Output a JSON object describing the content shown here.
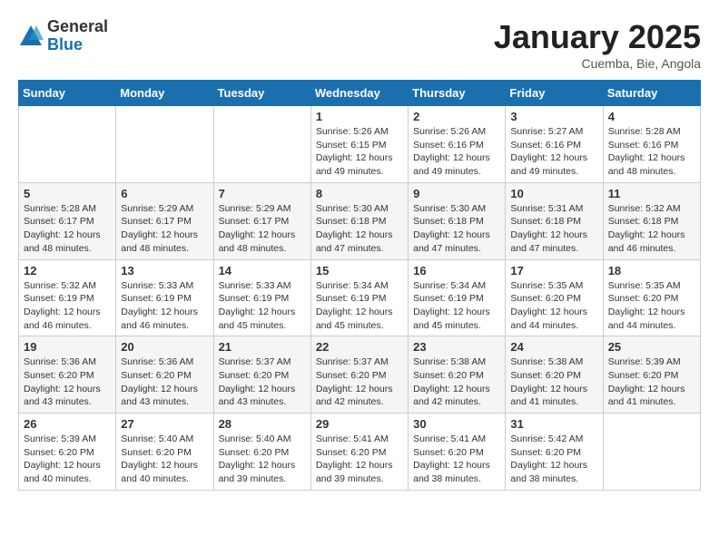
{
  "header": {
    "logo_general": "General",
    "logo_blue": "Blue",
    "month_title": "January 2025",
    "subtitle": "Cuemba, Bie, Angola"
  },
  "weekdays": [
    "Sunday",
    "Monday",
    "Tuesday",
    "Wednesday",
    "Thursday",
    "Friday",
    "Saturday"
  ],
  "weeks": [
    [
      {
        "day": "",
        "info": ""
      },
      {
        "day": "",
        "info": ""
      },
      {
        "day": "",
        "info": ""
      },
      {
        "day": "1",
        "info": "Sunrise: 5:26 AM\nSunset: 6:15 PM\nDaylight: 12 hours and 49 minutes."
      },
      {
        "day": "2",
        "info": "Sunrise: 5:26 AM\nSunset: 6:16 PM\nDaylight: 12 hours and 49 minutes."
      },
      {
        "day": "3",
        "info": "Sunrise: 5:27 AM\nSunset: 6:16 PM\nDaylight: 12 hours and 49 minutes."
      },
      {
        "day": "4",
        "info": "Sunrise: 5:28 AM\nSunset: 6:16 PM\nDaylight: 12 hours and 48 minutes."
      }
    ],
    [
      {
        "day": "5",
        "info": "Sunrise: 5:28 AM\nSunset: 6:17 PM\nDaylight: 12 hours and 48 minutes."
      },
      {
        "day": "6",
        "info": "Sunrise: 5:29 AM\nSunset: 6:17 PM\nDaylight: 12 hours and 48 minutes."
      },
      {
        "day": "7",
        "info": "Sunrise: 5:29 AM\nSunset: 6:17 PM\nDaylight: 12 hours and 48 minutes."
      },
      {
        "day": "8",
        "info": "Sunrise: 5:30 AM\nSunset: 6:18 PM\nDaylight: 12 hours and 47 minutes."
      },
      {
        "day": "9",
        "info": "Sunrise: 5:30 AM\nSunset: 6:18 PM\nDaylight: 12 hours and 47 minutes."
      },
      {
        "day": "10",
        "info": "Sunrise: 5:31 AM\nSunset: 6:18 PM\nDaylight: 12 hours and 47 minutes."
      },
      {
        "day": "11",
        "info": "Sunrise: 5:32 AM\nSunset: 6:18 PM\nDaylight: 12 hours and 46 minutes."
      }
    ],
    [
      {
        "day": "12",
        "info": "Sunrise: 5:32 AM\nSunset: 6:19 PM\nDaylight: 12 hours and 46 minutes."
      },
      {
        "day": "13",
        "info": "Sunrise: 5:33 AM\nSunset: 6:19 PM\nDaylight: 12 hours and 46 minutes."
      },
      {
        "day": "14",
        "info": "Sunrise: 5:33 AM\nSunset: 6:19 PM\nDaylight: 12 hours and 45 minutes."
      },
      {
        "day": "15",
        "info": "Sunrise: 5:34 AM\nSunset: 6:19 PM\nDaylight: 12 hours and 45 minutes."
      },
      {
        "day": "16",
        "info": "Sunrise: 5:34 AM\nSunset: 6:19 PM\nDaylight: 12 hours and 45 minutes."
      },
      {
        "day": "17",
        "info": "Sunrise: 5:35 AM\nSunset: 6:20 PM\nDaylight: 12 hours and 44 minutes."
      },
      {
        "day": "18",
        "info": "Sunrise: 5:35 AM\nSunset: 6:20 PM\nDaylight: 12 hours and 44 minutes."
      }
    ],
    [
      {
        "day": "19",
        "info": "Sunrise: 5:36 AM\nSunset: 6:20 PM\nDaylight: 12 hours and 43 minutes."
      },
      {
        "day": "20",
        "info": "Sunrise: 5:36 AM\nSunset: 6:20 PM\nDaylight: 12 hours and 43 minutes."
      },
      {
        "day": "21",
        "info": "Sunrise: 5:37 AM\nSunset: 6:20 PM\nDaylight: 12 hours and 43 minutes."
      },
      {
        "day": "22",
        "info": "Sunrise: 5:37 AM\nSunset: 6:20 PM\nDaylight: 12 hours and 42 minutes."
      },
      {
        "day": "23",
        "info": "Sunrise: 5:38 AM\nSunset: 6:20 PM\nDaylight: 12 hours and 42 minutes."
      },
      {
        "day": "24",
        "info": "Sunrise: 5:38 AM\nSunset: 6:20 PM\nDaylight: 12 hours and 41 minutes."
      },
      {
        "day": "25",
        "info": "Sunrise: 5:39 AM\nSunset: 6:20 PM\nDaylight: 12 hours and 41 minutes."
      }
    ],
    [
      {
        "day": "26",
        "info": "Sunrise: 5:39 AM\nSunset: 6:20 PM\nDaylight: 12 hours and 40 minutes."
      },
      {
        "day": "27",
        "info": "Sunrise: 5:40 AM\nSunset: 6:20 PM\nDaylight: 12 hours and 40 minutes."
      },
      {
        "day": "28",
        "info": "Sunrise: 5:40 AM\nSunset: 6:20 PM\nDaylight: 12 hours and 39 minutes."
      },
      {
        "day": "29",
        "info": "Sunrise: 5:41 AM\nSunset: 6:20 PM\nDaylight: 12 hours and 39 minutes."
      },
      {
        "day": "30",
        "info": "Sunrise: 5:41 AM\nSunset: 6:20 PM\nDaylight: 12 hours and 38 minutes."
      },
      {
        "day": "31",
        "info": "Sunrise: 5:42 AM\nSunset: 6:20 PM\nDaylight: 12 hours and 38 minutes."
      },
      {
        "day": "",
        "info": ""
      }
    ]
  ]
}
